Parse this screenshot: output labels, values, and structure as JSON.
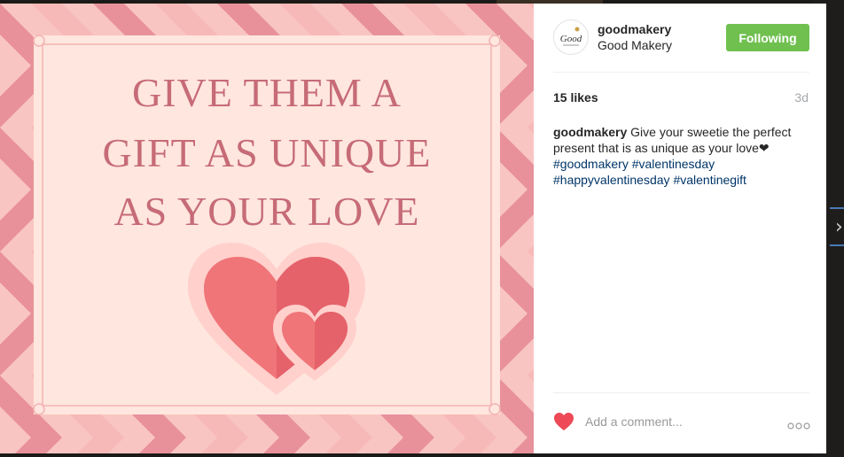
{
  "post": {
    "image_text": {
      "line1": "GIVE THEM A",
      "line2": "GIFT AS UNIQUE",
      "line3": "AS YOUR LOVE"
    },
    "colors": {
      "stripe_light": "#f9c5c2",
      "stripe_dark": "#e8919a",
      "frame_bg": "#ffe6df",
      "title_text": "#c66b77",
      "heart_main": "#f07578",
      "heart_shade": "#e5626a",
      "follow_green": "#70c050",
      "hashtag_blue": "#003569",
      "like_red": "#ed4956"
    }
  },
  "author": {
    "avatar_text": "Good",
    "username": "goodmakery",
    "full_name": "Good Makery"
  },
  "follow_button": {
    "label": "Following"
  },
  "stats": {
    "likes": "15 likes",
    "time_ago": "3d"
  },
  "caption": {
    "username": "goodmakery",
    "text": " Give your sweetie the perfect present that is as unique as your love❤ ",
    "hashtags": [
      "#goodmakery",
      "#valentinesday",
      "#happyvalentinesday",
      "#valentinegift"
    ]
  },
  "comment": {
    "placeholder": "Add a comment...",
    "like_icon": "heart-icon",
    "more_icon": "more-options-icon"
  }
}
